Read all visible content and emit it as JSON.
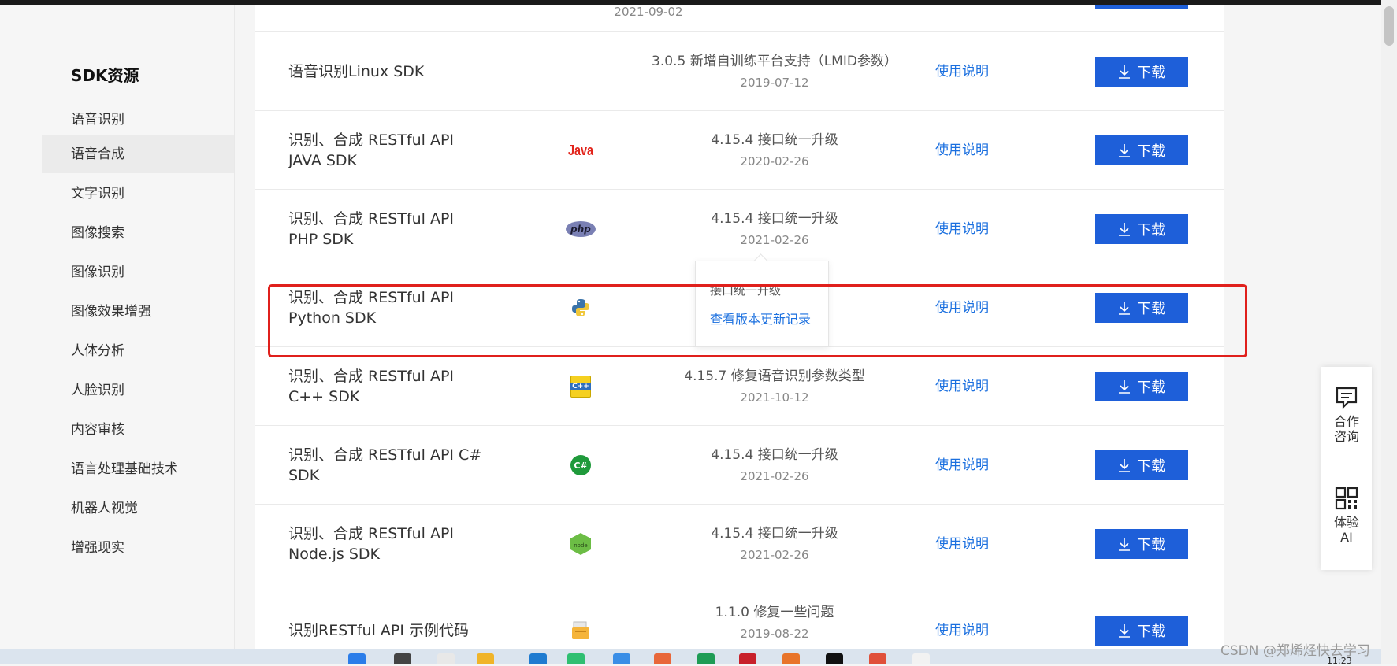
{
  "sidebar": {
    "title": "SDK资源",
    "items": [
      {
        "label": "语音识别",
        "active": false
      },
      {
        "label": "语音合成",
        "active": true
      },
      {
        "label": "文字识别",
        "active": false
      },
      {
        "label": "图像搜索",
        "active": false
      },
      {
        "label": "图像识别",
        "active": false
      },
      {
        "label": "图像效果增强",
        "active": false
      },
      {
        "label": "人体分析",
        "active": false
      },
      {
        "label": "人脸识别",
        "active": false
      },
      {
        "label": "内容审核",
        "active": false
      },
      {
        "label": "语言处理基础技术",
        "active": false
      },
      {
        "label": "机器人视觉",
        "active": false
      },
      {
        "label": "增强现实",
        "active": false
      }
    ]
  },
  "partial_row": {
    "date": "2021-09-02"
  },
  "rows": [
    {
      "name_line1": "语音识别Linux SDK",
      "name_line2": "",
      "logo": "",
      "version": "3.0.5 新增自训练平台支持（LMID参数）",
      "date": "2019-07-12",
      "link": "使用说明",
      "button": "下载"
    },
    {
      "name_line1": "识别、合成 RESTful API",
      "name_line2": "JAVA SDK",
      "logo": "java-logo",
      "logo_text": "Java",
      "version": "4.15.4 接口统一升级",
      "date": "2020-02-26",
      "link": "使用说明",
      "button": "下载"
    },
    {
      "name_line1": "识别、合成 RESTful API",
      "name_line2": "PHP SDK",
      "logo": "php-logo",
      "logo_text": "php",
      "version": "4.15.4 接口统一升级",
      "date": "2021-02-26",
      "link": "使用说明",
      "button": "下载"
    },
    {
      "name_line1": "识别、合成 RESTful API",
      "name_line2": "Python SDK",
      "logo": "python-logo",
      "version": "",
      "date": "",
      "link": "使用说明",
      "button": "下载"
    },
    {
      "name_line1": "识别、合成 RESTful API",
      "name_line2": "C++ SDK",
      "logo": "cpp-logo",
      "logo_text": "C++",
      "version": "4.15.7 修复语音识别参数类型",
      "date": "2021-10-12",
      "link": "使用说明",
      "button": "下载"
    },
    {
      "name_line1": "识别、合成 RESTful API C#",
      "name_line2": "SDK",
      "logo": "csharp-logo",
      "logo_text": "C#",
      "version": "4.15.4 接口统一升级",
      "date": "2021-02-26",
      "link": "使用说明",
      "button": "下载"
    },
    {
      "name_line1": "识别、合成 RESTful API",
      "name_line2": "Node.js SDK",
      "logo": "nodejs-logo",
      "logo_text": "node",
      "version": "4.15.4 接口统一升级",
      "date": "2021-02-26",
      "link": "使用说明",
      "button": "下载"
    },
    {
      "name_line1": "识别RESTful API 示例代码",
      "name_line2": "",
      "logo": "sample-code-logo",
      "version": "1.1.0 修复一些问题",
      "date": "2019-08-22",
      "link": "使用说明",
      "button": "下载"
    }
  ],
  "tooltip": {
    "text": "接口统一升级",
    "link": "查看版本更新记录"
  },
  "float_panel": {
    "consult_label_1": "合作",
    "consult_label_2": "咨询",
    "ai_label_1": "体验",
    "ai_label_2": "AI"
  },
  "taskbar": {
    "clock": "11:23"
  },
  "watermark": "CSDN @郑烯烃快去学习",
  "colors": {
    "accent": "#1e5fd9",
    "link": "#1a6fdf",
    "highlight": "#e0201c"
  }
}
